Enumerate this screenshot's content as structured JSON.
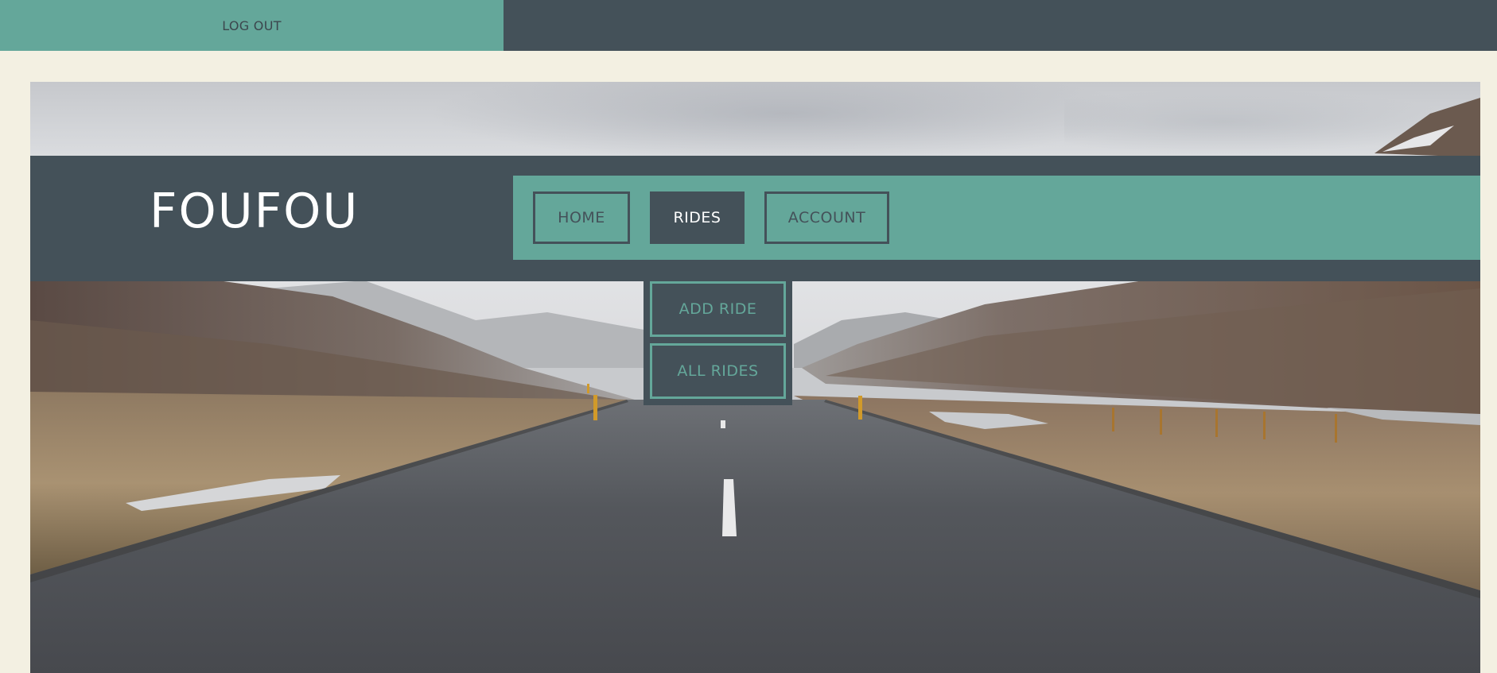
{
  "topbar": {
    "logout_label": "LOG OUT",
    "colors": {
      "accent": "#64a79a",
      "dark": "#445159"
    }
  },
  "header": {
    "brand": "FOUFOU",
    "nav": [
      {
        "label": "HOME",
        "active": false
      },
      {
        "label": "RIDES",
        "active": true
      },
      {
        "label": "ACCOUNT",
        "active": false
      }
    ]
  },
  "rides_dropdown": {
    "items": [
      {
        "label": "ADD RIDE"
      },
      {
        "label": "ALL RIDES"
      }
    ]
  },
  "hero": {
    "image_subject": "empty road through a mountain valley",
    "page_background": "#f3f0e2"
  }
}
